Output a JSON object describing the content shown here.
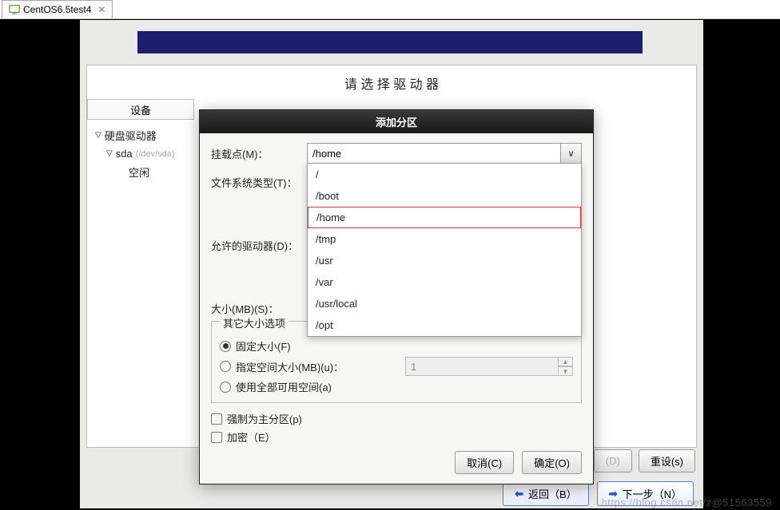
{
  "tabs": {
    "main": "CentOS6.5test4"
  },
  "installer": {
    "heading_partial": "请 选 择 驱 动 器"
  },
  "tree": {
    "header": "设备",
    "root": "硬盘驱动器",
    "disk": "sda",
    "disk_path": "(/dev/sda)",
    "free": "空闲"
  },
  "dialog": {
    "title": "添加分区",
    "mount_label": "挂载点(M)：",
    "mount_value": "/home",
    "fstype_label": "文件系统类型(T)：",
    "drives_label": "允许的驱动器(D)：",
    "size_label": "大小(MB)(S)：",
    "mount_options": [
      "/",
      "/boot",
      "/home",
      "/tmp",
      "/usr",
      "/var",
      "/usr/local",
      "/opt"
    ],
    "mount_selected": "/home",
    "other_size_legend": "其它大小选项",
    "radio_fixed": "固定大小(F)",
    "radio_upto": "指定空间大小(MB)(u)：",
    "radio_all": "使用全部可用空间(a)",
    "spin_value": "1",
    "chk_primary": "强制为主分区(p)",
    "chk_encrypt": "加密（E）",
    "cancel": "取消(C)",
    "ok": "确定(O)"
  },
  "bottom_buttons": {
    "d_label": "(D)",
    "reset": "重设(s)"
  },
  "wizard": {
    "back": "返回（B）",
    "next": "下一步（N）"
  },
  "watermark": "https://blog.csdn.net/z@51563559"
}
